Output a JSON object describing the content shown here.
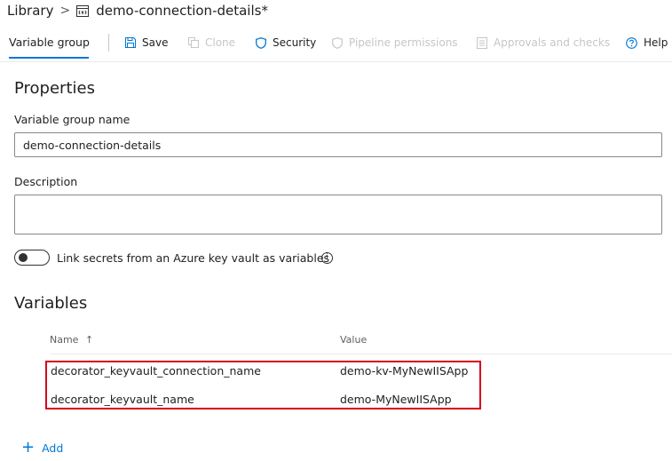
{
  "breadcrumb": {
    "library": "Library",
    "separator": ">",
    "group_name": "demo-connection-details*"
  },
  "toolbar": {
    "active_tab": "Variable group",
    "save": "Save",
    "clone": "Clone",
    "security": "Security",
    "pipeline_permissions": "Pipeline permissions",
    "approvals_and_checks": "Approvals and checks",
    "help": "Help"
  },
  "properties": {
    "title": "Properties",
    "name_label": "Variable group name",
    "name_value": "demo-connection-details",
    "description_label": "Description",
    "description_value": "",
    "link_secrets_label": "Link secrets from an Azure key vault as variables",
    "link_secrets_on": false,
    "info_glyph": "i"
  },
  "variables": {
    "title": "Variables",
    "columns": {
      "name": "Name",
      "sort_indicator": "↑",
      "value": "Value"
    },
    "rows": [
      {
        "name": "decorator_keyvault_connection_name",
        "value": "demo-kv-MyNewIISApp"
      },
      {
        "name": "decorator_keyvault_name",
        "value": "demo-MyNewIISApp"
      }
    ],
    "add_label": "Add",
    "add_glyph": "+"
  },
  "colors": {
    "accent": "#0078d4",
    "highlight_border": "#d6001c",
    "disabled_text": "#c8c6c4"
  }
}
